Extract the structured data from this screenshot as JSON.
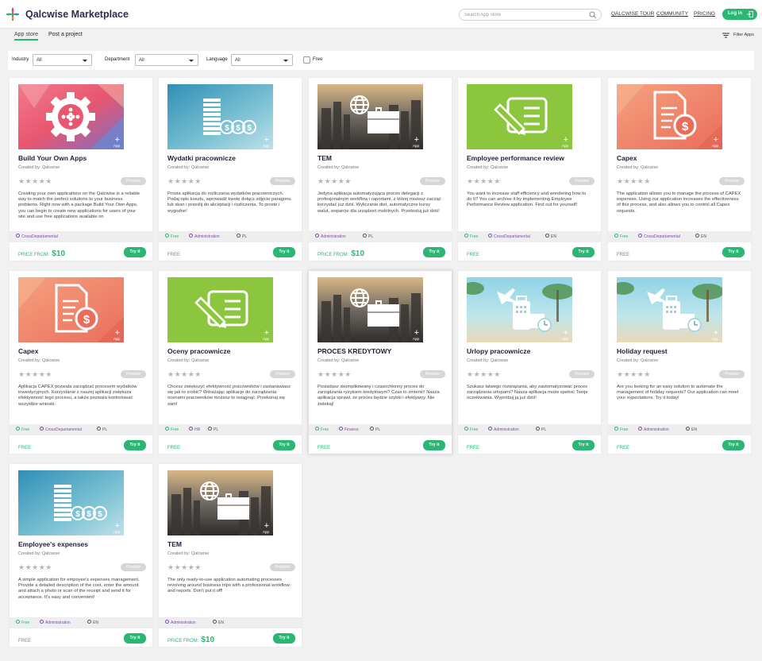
{
  "header": {
    "title": "Qalcwise Marketplace",
    "search_placeholder": "Search App store",
    "nav": [
      "QALCWISE TOUR",
      "COMMUNITY",
      "PRICING"
    ],
    "login_label": "Log in"
  },
  "tabs": [
    "App store",
    "Post a project"
  ],
  "filter_apps_label": "Filter Apps",
  "filters": {
    "industry": {
      "label": "Industry",
      "value": "All"
    },
    "department": {
      "label": "Department",
      "value": "All"
    },
    "language": {
      "label": "Language",
      "value": "All"
    },
    "free": {
      "label": "Free",
      "checked": false
    }
  },
  "common": {
    "created_by_prefix": "Created by:",
    "preview_label": "Preview",
    "try_label": "Try it",
    "stars": "★★★★★"
  },
  "cards": [
    {
      "title": "Build Your Own Apps",
      "creator": "Qalcwise",
      "banner": "gear",
      "description": "Creating your own applications on the Qalcwise is a reliable way to match the perfect solutions to your business problems. Right now with a package Build Your Own Apps, you can begin to create new applications for users of your site and use free applications available on",
      "tags": [
        {
          "type": "cat",
          "text": "CrossDepartamental"
        }
      ],
      "price_label": "PRICE FROM:",
      "price_amount": "$10"
    },
    {
      "title": "Wydatki pracownicze",
      "creator": "Qalcwise",
      "banner": "coins",
      "description": "Prosta aplikacja do rozliczania wydatków pracowniczych. Podaj opis kosztu, wprowadź kwotę dołącz zdjęcie paragonu lub skan i prześlij do akceptacji i rozliczenia. To proste i wygodne!",
      "tags": [
        {
          "type": "free",
          "text": "Free"
        },
        {
          "type": "cat",
          "text": "Administration"
        },
        {
          "type": "lang",
          "text": "PL"
        }
      ],
      "price_label": "FREE",
      "price_amount": ""
    },
    {
      "title": "TEM",
      "creator": "Qalcwise",
      "banner": "travel-city",
      "description": "Jedyna aplikacja automatyzująca proces delegacji z profesjonalnym workflow i raportami, z której możesz zacząć korzystać już dziś. Wyliczanie diet, automatyczne kursy walut, wsparcie dla urządzeń mobilnych. Przetestuj już dziś!",
      "tags": [
        {
          "type": "cat",
          "text": "Administration"
        },
        {
          "type": "lang",
          "text": "PL"
        }
      ],
      "price_label": "PRICE FROM:",
      "price_amount": "$10"
    },
    {
      "title": "Employee performance review",
      "creator": "Qalcwise",
      "banner": "review",
      "description": "You want to increase staff efficiency and wondering how to do it? You can archive it by implementing Employee Performance Review application. Find out for yourself!",
      "tags": [
        {
          "type": "free",
          "text": "Free"
        },
        {
          "type": "cat",
          "text": "CrossDepartamental"
        },
        {
          "type": "lang",
          "text": "EN"
        }
      ],
      "price_label": "FREE",
      "price_amount": ""
    },
    {
      "title": "Capex",
      "creator": "Qalcwise",
      "banner": "capex",
      "description": "The application allows you to manage the process of CAPEX expenses. Using our application increases the effectiveness of this process, and also allows you to control all Capex requests.",
      "tags": [
        {
          "type": "free",
          "text": "Free"
        },
        {
          "type": "cat",
          "text": "CrossDepartamental"
        },
        {
          "type": "lang",
          "text": "EN"
        }
      ],
      "price_label": "FREE",
      "price_amount": ""
    },
    {
      "title": "Capex",
      "creator": "Qalcwise",
      "banner": "capex",
      "description": "Aplikacja CAPEX pozwala zarządzać procesem wydatków inwestycyjnych. Korzystanie z naszej aplikacji zwiększa efektywność tego procesu, a także pozwala kontrolować wszystkie wnioski.",
      "tags": [
        {
          "type": "free",
          "text": "Free"
        },
        {
          "type": "cat",
          "text": "CrossDepartamental"
        },
        {
          "type": "lang",
          "text": "PL"
        }
      ],
      "price_label": "FREE",
      "price_amount": ""
    },
    {
      "title": "Oceny pracownicze",
      "creator": "Qalcwise",
      "banner": "review",
      "description": "Chcesz zwiększyć efektywność pracowników i zastanawiasz się jak to zrobić? Wdrażając aplikacje do zarządzania ocenami pracowników możesz to osiągnąć. Przekonaj się sam!",
      "tags": [
        {
          "type": "free",
          "text": "Free"
        },
        {
          "type": "cat",
          "text": "HR"
        },
        {
          "type": "lang",
          "text": "PL"
        }
      ],
      "price_label": "FREE",
      "price_amount": ""
    },
    {
      "title": "PROCES KREDYTOWY",
      "creator": "Qalcwise",
      "banner": "travel-city",
      "description": "Posiadasz skomplikowany i czasochłonny proces do zarządzania ryzykiem kredytowym? Czas to zmienić! Nasza aplikacja sprawi, że proces będzie szybki i efektywny. Nie zwlekaj!",
      "tags": [
        {
          "type": "free",
          "text": "Free"
        },
        {
          "type": "cat",
          "text": "Finance"
        },
        {
          "type": "lang",
          "text": "PL"
        }
      ],
      "price_label": "FREE",
      "price_amount": ""
    },
    {
      "title": "Urlopy pracownicze",
      "creator": "Qalcwise",
      "banner": "holiday",
      "description": "Szukasz łatwego rozwiązania, aby zautomatyzować proces zarządzania urlopami? Nasza aplikacja może spełnić Twoje oczekiwania. Wypróbuj ją już dziś!",
      "tags": [
        {
          "type": "free",
          "text": "Free"
        },
        {
          "type": "cat",
          "text": "Administration"
        },
        {
          "type": "lang",
          "text": "PL"
        }
      ],
      "price_label": "FREE",
      "price_amount": ""
    },
    {
      "title": "Holiday request",
      "creator": "Qalcwise",
      "banner": "holiday",
      "description": "Are you looking for an easy solution to automate the management of holiday requests? Our application can meet your expectations. Try it today!",
      "tags": [
        {
          "type": "free",
          "text": "Free"
        },
        {
          "type": "cat",
          "text": "Administration"
        },
        {
          "type": "lang",
          "text": "EN"
        }
      ],
      "price_label": "FREE",
      "price_amount": ""
    },
    {
      "title": "Employee's expenses",
      "creator": "Qalcwise",
      "banner": "coins",
      "description": "A simple application for empoyee's expenses management. Provide a detailed description of the cost, enter the amount and attach a photo or scan of the receipt and send it for acceptance. It's easy and convenient!",
      "tags": [
        {
          "type": "free",
          "text": "Free"
        },
        {
          "type": "cat",
          "text": "Administration"
        },
        {
          "type": "lang",
          "text": "EN"
        }
      ],
      "price_label": "FREE",
      "price_amount": ""
    },
    {
      "title": "TEM",
      "creator": "Qalcwise",
      "banner": "travel-city",
      "description": "The only ready-to-use application automating processes revolving around business trips with a professional workflow and reports. Don't put it off!",
      "tags": [
        {
          "type": "cat",
          "text": "Administration"
        },
        {
          "type": "lang",
          "text": "EN"
        }
      ],
      "price_label": "PRICE FROM:",
      "price_amount": "$10"
    }
  ]
}
